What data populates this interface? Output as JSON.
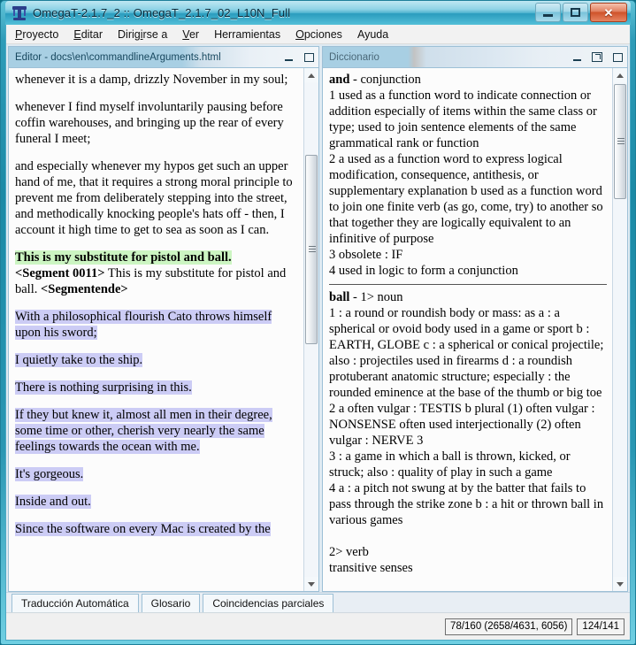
{
  "window": {
    "title": "OmegaT-2.1.7_2 :: OmegaT_2.1.7_02_L10N_Full",
    "icon": "omegat-logo-icon",
    "controls": {
      "minimize": "minimize-icon",
      "maximize": "maximize-icon",
      "close": "✕"
    }
  },
  "menubar": {
    "items": [
      {
        "pre": "P",
        "rest": "royecto"
      },
      {
        "pre": "E",
        "rest": "ditar"
      },
      {
        "pre": "Dirig",
        "rest": "irse a",
        "mnemonic_index": 4
      },
      {
        "pre": "V",
        "rest": "er"
      },
      {
        "pre": "H",
        "rest": "erramientas"
      },
      {
        "pre": "O",
        "rest": "pciones"
      },
      {
        "pre": "A",
        "rest": "yuda"
      }
    ],
    "labels": [
      "Proyecto",
      "Editar",
      "Dirigirse a",
      "Ver",
      "Herramientas",
      "Opciones",
      "Ayuda"
    ]
  },
  "editor_panel": {
    "title": "Editor - docs\\en\\commandlineArguments.html",
    "minimize_label": "minimize-icon",
    "maximize_label": "maximize-icon",
    "paragraphs": [
      {
        "type": "plain",
        "text": "whenever it is a damp, drizzly November in my soul;"
      },
      {
        "type": "plain",
        "text": "whenever I find myself involuntarily pausing before coffin warehouses, and bringing up the rear of every funeral I meet;"
      },
      {
        "type": "plain",
        "text": "and especially whenever my hypos get such an upper hand of me, that it requires a strong moral principle to prevent me from deliberately stepping into the street, and methodically knocking people's hats off - then, I account it high time to get to sea as soon as I can."
      }
    ],
    "active_segment": {
      "source": "This is my substitute for pistol and ball.",
      "marker_start": "<Segment 0011>",
      "target": "This is my substitute for pistol and ball.",
      "marker_end": "<Segmentende>"
    },
    "translated_segments": [
      "With a philosophical flourish Cato throws himself upon his sword;",
      "I quietly take to the ship.",
      "There is nothing surprising in this.",
      "If they but knew it, almost all men in their degree, some time or other, cherish very nearly the same feelings towards the ocean with me.",
      "It's gorgeous.",
      "Inside and out.",
      "Since the software on every Mac is created by the"
    ],
    "highlight_active_color": "#ccf5c2",
    "highlight_translated_color": "#ccccf5"
  },
  "dictionary_panel": {
    "title": "Diccionario",
    "minimize_label": "minimize-icon",
    "undock_label": "undock-icon",
    "maximize_label": "maximize-icon",
    "entries": [
      {
        "headword": "and",
        "pos": "- conjunction",
        "senses": [
          "1 used as a function word to indicate connection or addition especially of items within the same class or type; used to join sentence elements of the same grammatical rank or function",
          "2 a used as a function word to express logical modification, consequence, antithesis, or supplementary explanation b used as a function word to join one finite verb (as go, come, try) to another so that together they are logically equivalent to an infinitive of purpose",
          "3 obsolete : IF",
          "4 used in logic to form a conjunction"
        ]
      },
      {
        "headword": "ball",
        "pos": "- 1> noun",
        "senses": [
          "1 : a round or roundish body or mass: as a : a spherical or ovoid body used in a game or sport b : EARTH, GLOBE c : a spherical or conical projectile; also : projectiles used in firearms d : a roundish protuberant anatomic structure; especially : the rounded eminence at the base of the thumb or big toe",
          "2 a often vulgar : TESTIS b plural (1) often vulgar : NONSENSE often used interjectionally (2) often vulgar : NERVE 3",
          "3 : a game in which a ball is thrown, kicked, or struck; also : quality of play in such a game",
          "4 a : a pitch not swung at by the batter that fails to pass through the strike zone b : a hit or thrown ball in various games"
        ],
        "subentry": "2> verb",
        "subentry_note": "transitive senses"
      }
    ]
  },
  "tabs": [
    {
      "label": "Traducción Automática"
    },
    {
      "label": "Glosario"
    },
    {
      "label": "Coincidencias parciales"
    }
  ],
  "statusbar": {
    "segment_progress": "78/160 (2658/4631, 6056)",
    "file_progress": "124/141"
  }
}
